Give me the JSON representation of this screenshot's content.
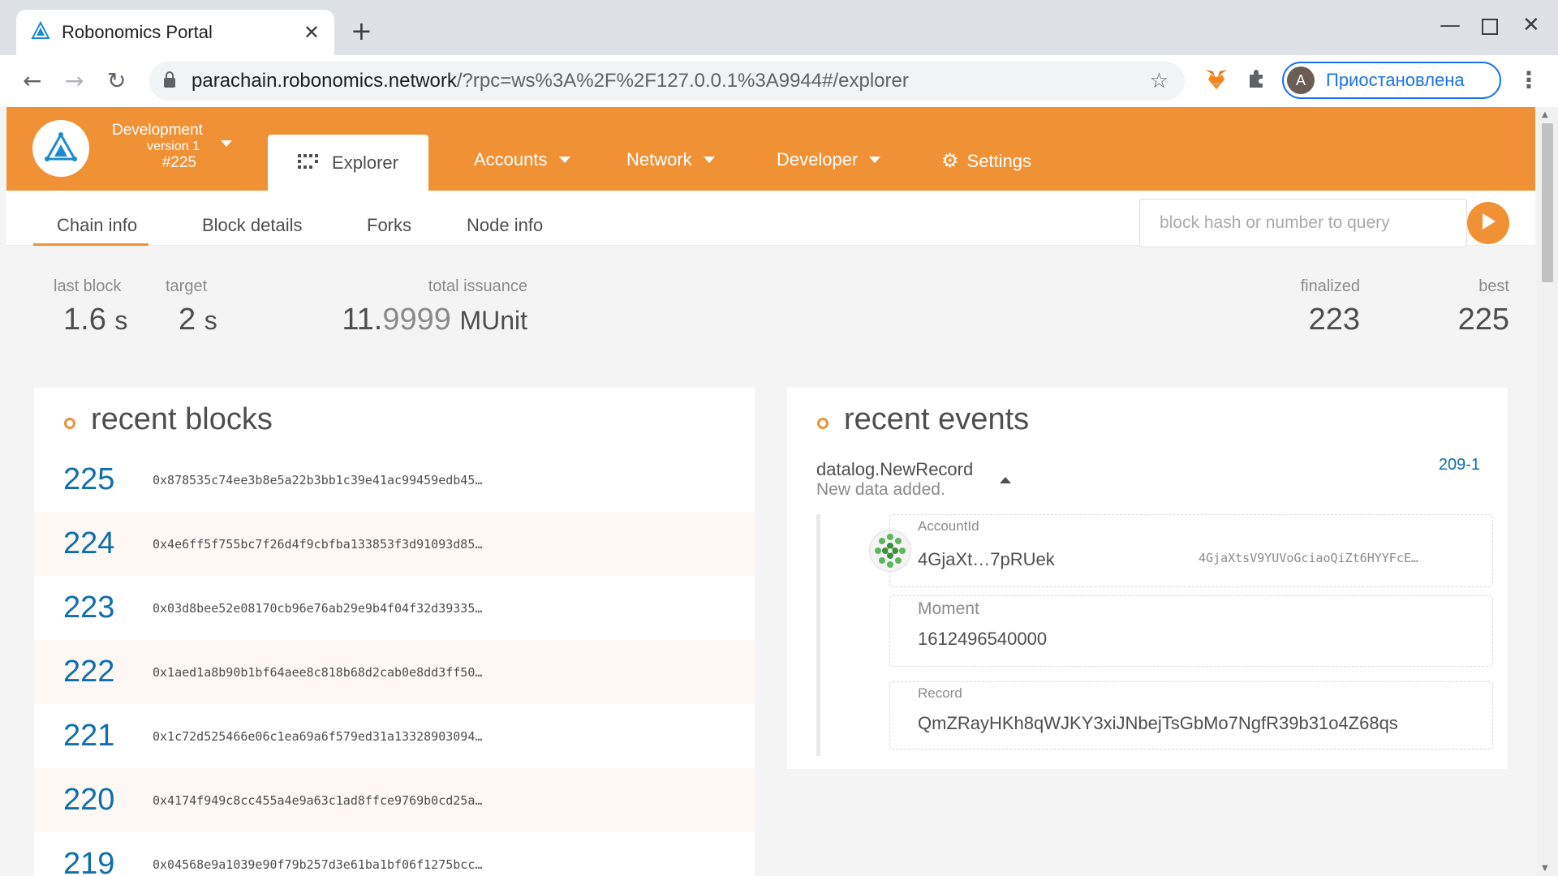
{
  "browser": {
    "tab_title": "Robonomics Portal",
    "tab_close": "✕",
    "new_tab": "+",
    "url_host": "parachain.robonomics.network",
    "url_path": "/?rpc=ws%3A%2F%2F127.0.0.1%3A9944#/explorer",
    "profile_initial": "A",
    "profile_label": "Приостановлена",
    "icons": [
      "back-icon",
      "forward-icon",
      "reload-icon",
      "lock-icon",
      "star-icon",
      "metamask-icon",
      "extensions-icon",
      "menu-icon"
    ]
  },
  "app": {
    "accent": "#f19135",
    "link": "#0e6faa",
    "chain": {
      "name": "Development",
      "version": "version 1",
      "block": "#225"
    },
    "menu": [
      {
        "label": "Explorer",
        "icon": "explorer-icon"
      },
      {
        "label": "Accounts"
      },
      {
        "label": "Network"
      },
      {
        "label": "Developer"
      },
      {
        "label": "Settings",
        "icon": "gear-icon"
      }
    ],
    "subnav": [
      "Chain info",
      "Block details",
      "Forks",
      "Node info"
    ],
    "query_placeholder": "block hash or number to query"
  },
  "summary": {
    "last_block": {
      "label": "last block",
      "value": "1.6",
      "unit": "s"
    },
    "target": {
      "label": "target",
      "value": "2",
      "unit": "s"
    },
    "issuance": {
      "label": "total issuance",
      "int": "11.",
      "frac": "9999",
      "unit": "MUnit"
    },
    "finalized": {
      "label": "finalized",
      "value": "223"
    },
    "best": {
      "label": "best",
      "value": "225"
    }
  },
  "blocks": {
    "title": "recent blocks",
    "rows": [
      {
        "num": "225",
        "hash": "0x878535c74ee3b8e5a22b3bb1c39e41ac99459edb45…"
      },
      {
        "num": "224",
        "hash": "0x4e6ff5f755bc7f26d4f9cbfba133853f3d91093d85…"
      },
      {
        "num": "223",
        "hash": "0x03d8bee52e08170cb96e76ab29e9b4f04f32d39335…"
      },
      {
        "num": "222",
        "hash": "0x1aed1a8b90b1bf64aee8c818b68d2cab0e8dd3ff50…"
      },
      {
        "num": "221",
        "hash": "0x1c72d525466e06c1ea69a6f579ed31a13328903094…"
      },
      {
        "num": "220",
        "hash": "0x4174f949c8cc455a4e9a63c1ad8ffce9769b0cd25a…"
      },
      {
        "num": "219",
        "hash": "0x04568e9a1039e90f79b257d3e61ba1bf06f1275bcc…"
      }
    ]
  },
  "events": {
    "title": "recent events",
    "name": "datalog.NewRecord",
    "description": "New data added.",
    "id": "209-1",
    "params": {
      "account_label": "AccountId",
      "account_short": "4GjaXt…7pRUek",
      "account_full": "4GjaXtsV9YUVoGciaoQiZt6HYYFcE…",
      "moment_label": "Moment",
      "moment_value": "1612496540000",
      "record_label": "Record",
      "record_value": "QmZRayHKh8qWJKY3xiJNbejTsGbMo7NgfR39b31o4Z68qs"
    }
  }
}
